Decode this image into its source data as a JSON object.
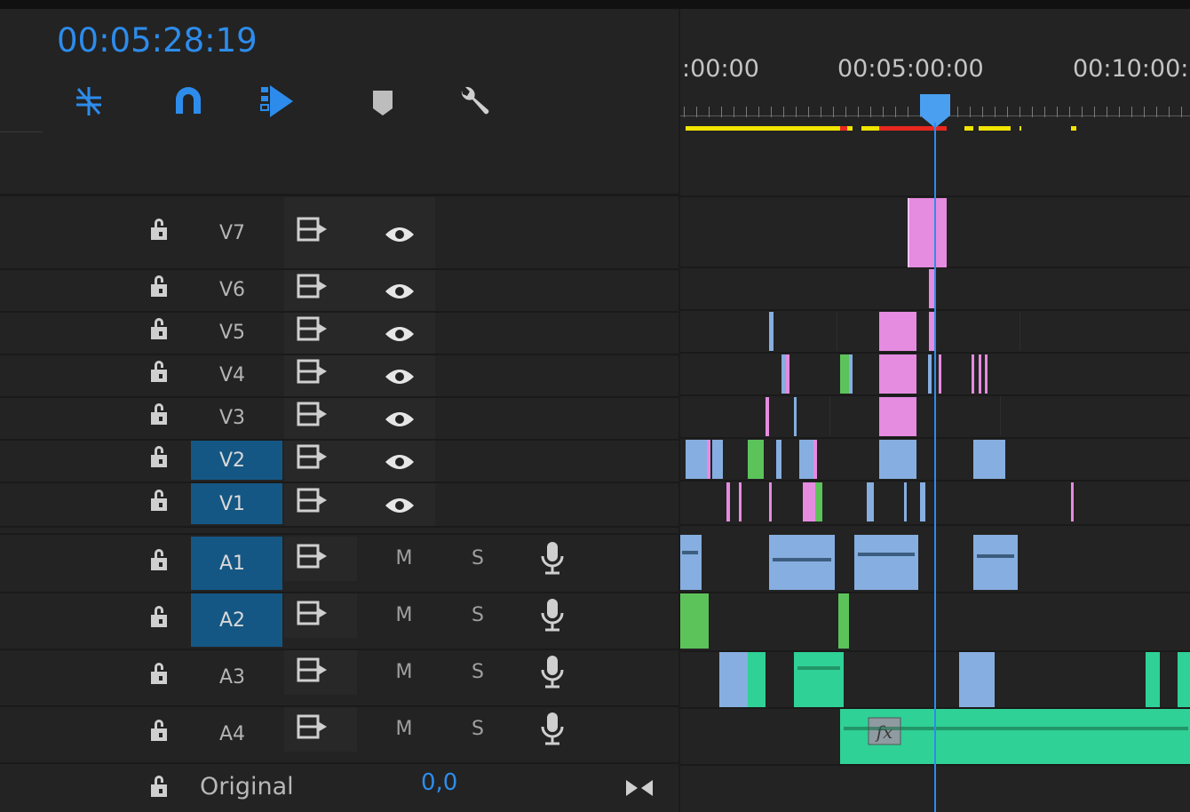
{
  "timecode": "00:05:28:19",
  "toolbar": {
    "tools": [
      {
        "name": "insert-overwrite-sequence-icon"
      },
      {
        "name": "snap-magnet-icon"
      },
      {
        "name": "linked-selection-icon"
      },
      {
        "name": "add-marker-icon"
      },
      {
        "name": "timeline-settings-wrench-icon"
      }
    ]
  },
  "ruler": {
    "labels": [
      ":00:00",
      "00:05:00:00",
      "00:10:00:"
    ]
  },
  "video_tracks": [
    {
      "name": "V7",
      "selected": false
    },
    {
      "name": "V6",
      "selected": false
    },
    {
      "name": "V5",
      "selected": false
    },
    {
      "name": "V4",
      "selected": false
    },
    {
      "name": "V3",
      "selected": false
    },
    {
      "name": "V2",
      "selected": true
    },
    {
      "name": "V1",
      "selected": true
    }
  ],
  "audio_tracks": [
    {
      "name": "A1",
      "selected": true,
      "mute": "M",
      "solo": "S"
    },
    {
      "name": "A2",
      "selected": true,
      "mute": "M",
      "solo": "S"
    },
    {
      "name": "A3",
      "selected": false,
      "mute": "M",
      "solo": "S"
    },
    {
      "name": "A4",
      "selected": false,
      "mute": "M",
      "solo": "S"
    }
  ],
  "master": {
    "label": "Original",
    "value": "0,0"
  },
  "clip_badge": "fx",
  "colors": {
    "accent": "#2d8ceb",
    "selected_track": "#155784",
    "clip_pink": "#e58be0",
    "clip_blue": "#86aee0",
    "clip_green": "#5cc35a",
    "clip_teal": "#2fd196",
    "render_yellow": "#f0e400",
    "render_red": "#e8281e"
  }
}
